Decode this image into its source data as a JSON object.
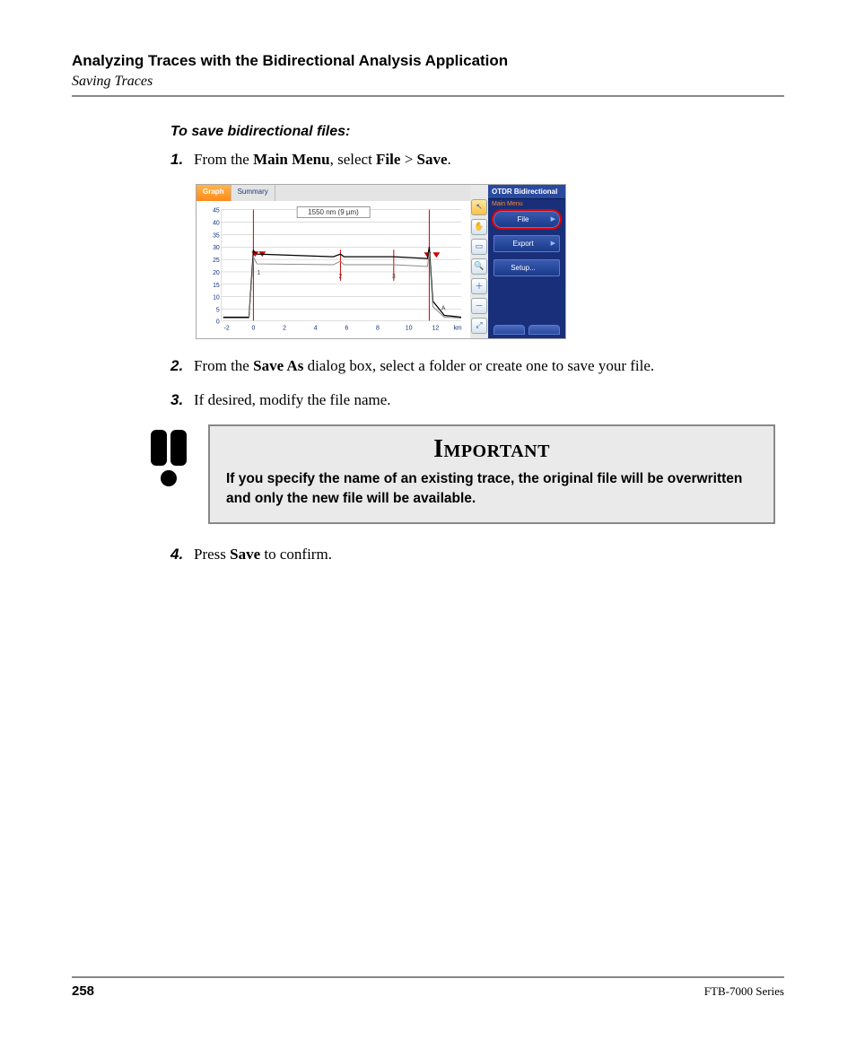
{
  "header": {
    "chapter": "Analyzing Traces with the Bidirectional Analysis Application",
    "section": "Saving Traces"
  },
  "subheading": "To save bidirectional files:",
  "steps": {
    "s1": {
      "num": "1.",
      "pre": "From the ",
      "b1": "Main Menu",
      "mid": ", select ",
      "b2": "File",
      "gt": " > ",
      "b3": "Save",
      "post": "."
    },
    "s2": {
      "num": "2.",
      "pre": "From the ",
      "b1": "Save As",
      "post": " dialog box, select a folder or create one to save your file."
    },
    "s3": {
      "num": "3.",
      "text": "If desired, modify the file name."
    },
    "s4": {
      "num": "4.",
      "pre": "Press ",
      "b1": "Save",
      "post": " to confirm."
    }
  },
  "screenshot": {
    "tabs": {
      "graph": "Graph",
      "summary": "Summary"
    },
    "legend": "1550 nm (9 µm)",
    "right_header": "OTDR Bidirectional",
    "right_sub": "Main Menu",
    "menu": {
      "file": "File",
      "export": "Export",
      "setup": "Setup..."
    },
    "y_ticks": [
      "45",
      "40",
      "35",
      "30",
      "25",
      "20",
      "15",
      "10",
      "5",
      "0"
    ],
    "x_ticks": [
      "-2",
      "0",
      "2",
      "4",
      "6",
      "8",
      "10",
      "12",
      "km"
    ]
  },
  "chart_data": {
    "type": "line",
    "title": "1550 nm (9 µm)",
    "xlabel": "km",
    "ylabel": "",
    "xlim": [
      -2,
      13
    ],
    "ylim": [
      0,
      45
    ],
    "event_markers_x": [
      0,
      5.5,
      9,
      11.5
    ],
    "event_labels": [
      "1",
      "2",
      "3",
      "A"
    ],
    "series": [
      {
        "name": "trace-top",
        "x": [
          -2,
          -0.2,
          0,
          0.1,
          1,
          5.4,
          5.5,
          5.6,
          9,
          11.4,
          11.5,
          11.6,
          12,
          13
        ],
        "y": [
          2,
          2,
          28,
          27,
          27,
          26,
          27,
          26,
          26,
          25.5,
          30,
          8,
          3,
          2
        ]
      },
      {
        "name": "trace-bottom",
        "x": [
          -2,
          -0.2,
          0,
          0.1,
          1,
          5.4,
          5.5,
          5.6,
          9,
          11.4,
          11.5,
          11.6,
          12,
          13
        ],
        "y": [
          2,
          2,
          26,
          23,
          23,
          23,
          24,
          23,
          23,
          22.5,
          28,
          6,
          2.5,
          2
        ]
      }
    ]
  },
  "important": {
    "title": "Important",
    "text": "If you specify the name of an existing trace, the original file will be overwritten and only the new file will be available."
  },
  "footer": {
    "page": "258",
    "series": "FTB-7000 Series"
  }
}
